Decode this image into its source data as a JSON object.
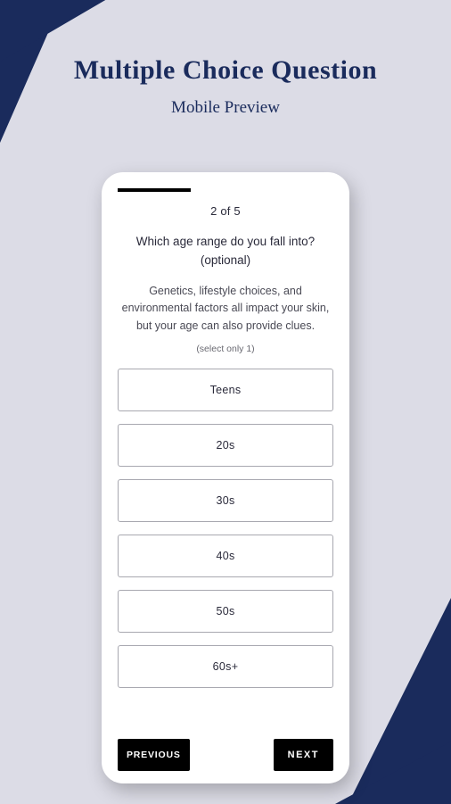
{
  "header": {
    "title": "Multiple Choice Question",
    "subtitle": "Mobile Preview"
  },
  "quiz": {
    "step_label": "2  of  5",
    "question": "Which age range do you fall into? (optional)",
    "description": "Genetics, lifestyle choices, and environmental factors all impact your skin, but your age can also provide clues.",
    "select_hint": "(select only 1)",
    "options": [
      {
        "label": "Teens"
      },
      {
        "label": "20s"
      },
      {
        "label": "30s"
      },
      {
        "label": "40s"
      },
      {
        "label": "50s"
      },
      {
        "label": "60s+"
      }
    ]
  },
  "nav": {
    "prev_label": "PREVIOUS",
    "next_label": "NEXT"
  }
}
